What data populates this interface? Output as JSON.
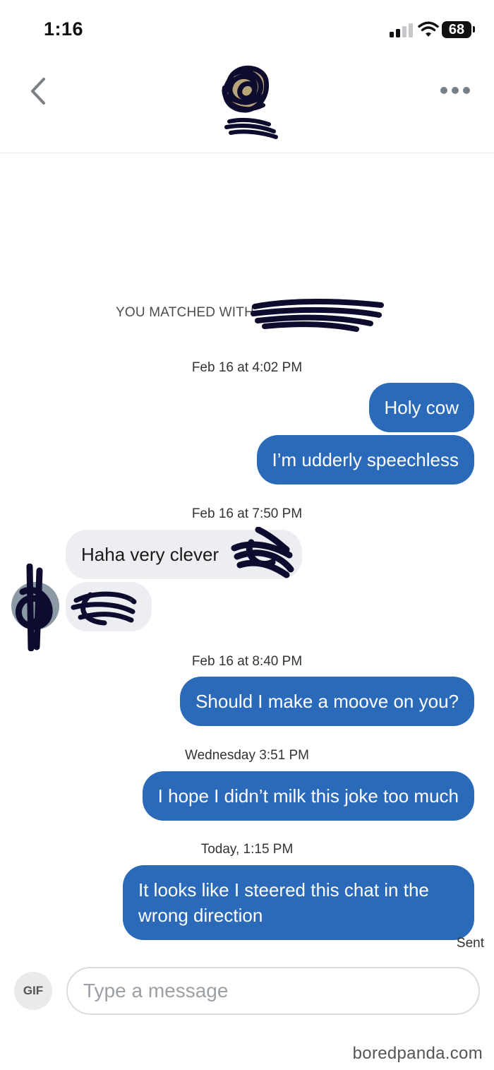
{
  "status_bar": {
    "time": "1:16",
    "battery": "68"
  },
  "header": {
    "back_icon": "chevron-left-icon",
    "more_icon": "ellipsis-icon"
  },
  "match_banner": {
    "text": "YOU MATCHED WITH"
  },
  "messages": [
    {
      "timestamp": "Feb 16 at 4:02 PM"
    },
    {
      "direction": "out",
      "text": "Holy cow"
    },
    {
      "direction": "out",
      "text": "I’m udderly speechless"
    },
    {
      "timestamp": "Feb 16 at 7:50 PM"
    },
    {
      "direction": "in",
      "text": "Haha very clever"
    },
    {
      "direction": "in",
      "text": ""
    },
    {
      "timestamp": "Feb 16 at 8:40 PM"
    },
    {
      "direction": "out",
      "text": "Should I make a moove on you?"
    },
    {
      "timestamp": "Wednesday 3:51 PM"
    },
    {
      "direction": "out",
      "text": "I hope I didn’t milk this joke too much"
    },
    {
      "timestamp": "Today, 1:15 PM"
    },
    {
      "direction": "out",
      "line1": "It looks like I steered this chat in the",
      "line2": "wrong direction"
    }
  ],
  "sent_status": "Sent",
  "composer": {
    "gif_label": "GIF",
    "placeholder": "Type a message"
  },
  "watermark": "boredpanda.com",
  "colors": {
    "outgoing_bubble": "#2a6ab8",
    "incoming_bubble": "#eceef1",
    "redaction_ink": "#0d0b2e"
  }
}
